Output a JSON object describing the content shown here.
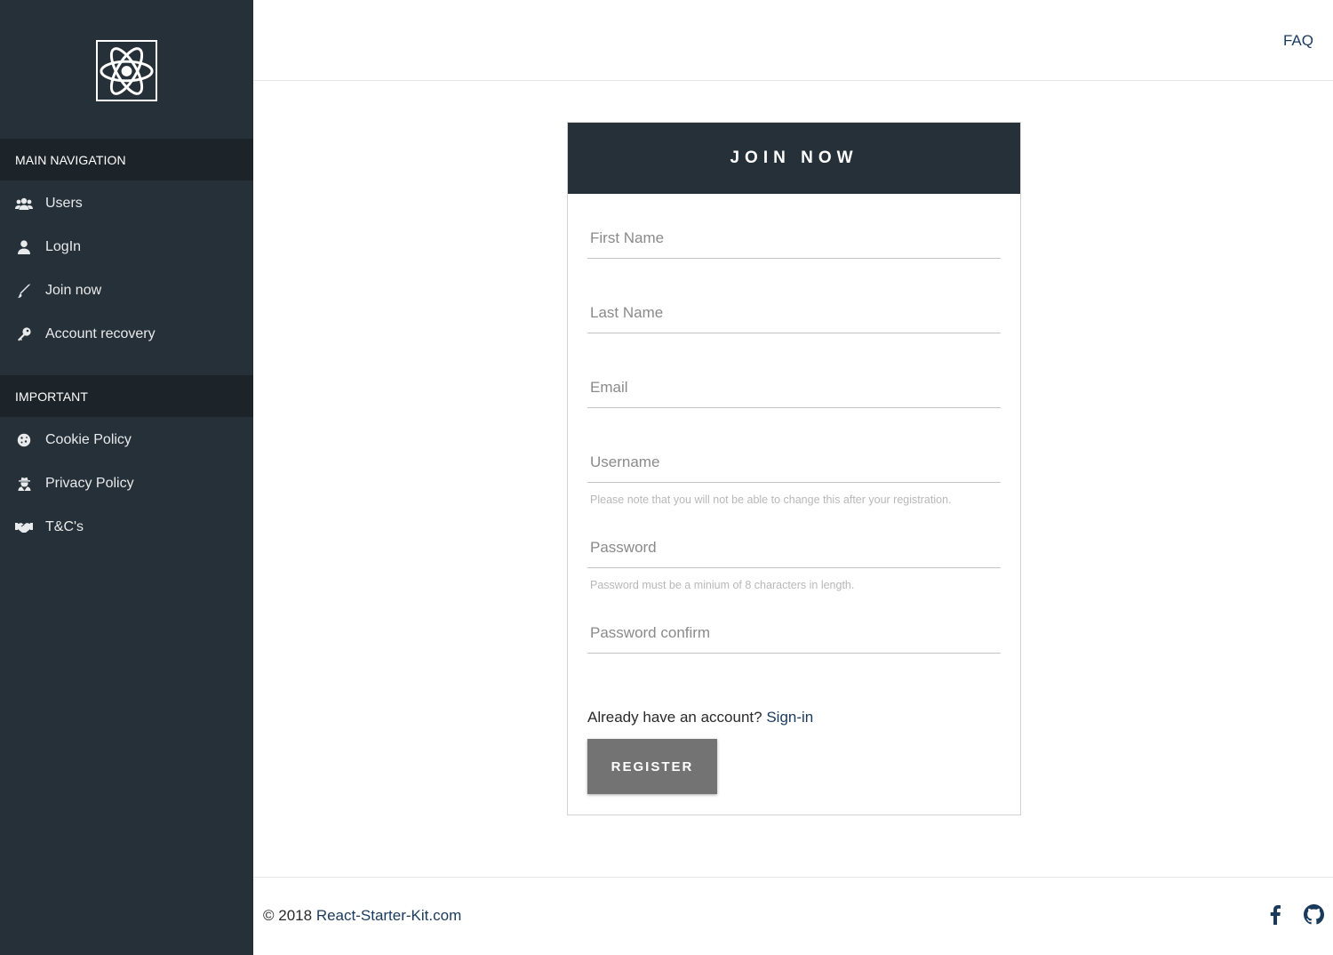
{
  "sidebar": {
    "logo_icon": "react-atom-icon",
    "sections": [
      {
        "header": "MAIN NAVIGATION",
        "items": [
          {
            "label": "Users",
            "icon": "users-icon"
          },
          {
            "label": "LogIn",
            "icon": "user-icon"
          },
          {
            "label": "Join now",
            "icon": "pencil-icon"
          },
          {
            "label": "Account recovery",
            "icon": "key-icon"
          }
        ]
      },
      {
        "header": "IMPORTANT",
        "items": [
          {
            "label": "Cookie Policy",
            "icon": "cookie-icon"
          },
          {
            "label": "Privacy Policy",
            "icon": "user-secret-icon"
          },
          {
            "label": "T&C's",
            "icon": "handshake-icon"
          }
        ]
      }
    ]
  },
  "topbar": {
    "faq_label": "FAQ"
  },
  "form": {
    "title": "JOIN NOW",
    "fields": {
      "first_name": {
        "placeholder": "First Name",
        "value": ""
      },
      "last_name": {
        "placeholder": "Last Name",
        "value": ""
      },
      "email": {
        "placeholder": "Email",
        "value": ""
      },
      "username": {
        "placeholder": "Username",
        "value": "",
        "hint": "Please note that you will not be able to change this after your registration."
      },
      "password": {
        "placeholder": "Password",
        "value": "",
        "hint": "Password must be a minium of 8 characters in length."
      },
      "password_confirm": {
        "placeholder": "Password confirm",
        "value": ""
      }
    },
    "already_text": "Already have an account?",
    "signin_label": "Sign-in",
    "register_label": "REGISTER"
  },
  "footer": {
    "copyright_prefix": "© 2018",
    "site_link": "React-Starter-Kit.com",
    "social": [
      "facebook-icon",
      "github-icon"
    ]
  },
  "colors": {
    "sidebar_bg": "#263038",
    "sidebar_header_bg": "#1c242a",
    "link": "#1a3a5c",
    "button_bg": "#737373"
  }
}
